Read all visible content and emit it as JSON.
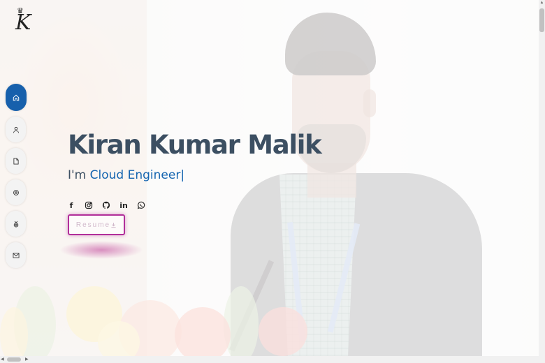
{
  "logo": {
    "letter": "K",
    "crown": "♛"
  },
  "nav": [
    {
      "icon": "home-icon",
      "active": true
    },
    {
      "icon": "user-icon",
      "active": false
    },
    {
      "icon": "document-icon",
      "active": false
    },
    {
      "icon": "gear-icon",
      "active": false
    },
    {
      "icon": "award-icon",
      "active": false
    },
    {
      "icon": "mail-icon",
      "active": false
    }
  ],
  "hero": {
    "name": "Kiran Kumar Malik",
    "prefix": "I'm ",
    "role": "Cloud Engineer",
    "cursor": "|"
  },
  "socials": [
    {
      "icon": "facebook-icon",
      "glyph": "f"
    },
    {
      "icon": "instagram-icon",
      "glyph": ""
    },
    {
      "icon": "github-icon",
      "glyph": ""
    },
    {
      "icon": "linkedin-icon",
      "glyph": "in"
    },
    {
      "icon": "whatsapp-icon",
      "glyph": ""
    }
  ],
  "resume": {
    "label": "Resume",
    "icon": "download-icon"
  },
  "colors": {
    "accent": "#1760ac",
    "name": "#3c4f62",
    "resume_border": "#b12f9a"
  }
}
